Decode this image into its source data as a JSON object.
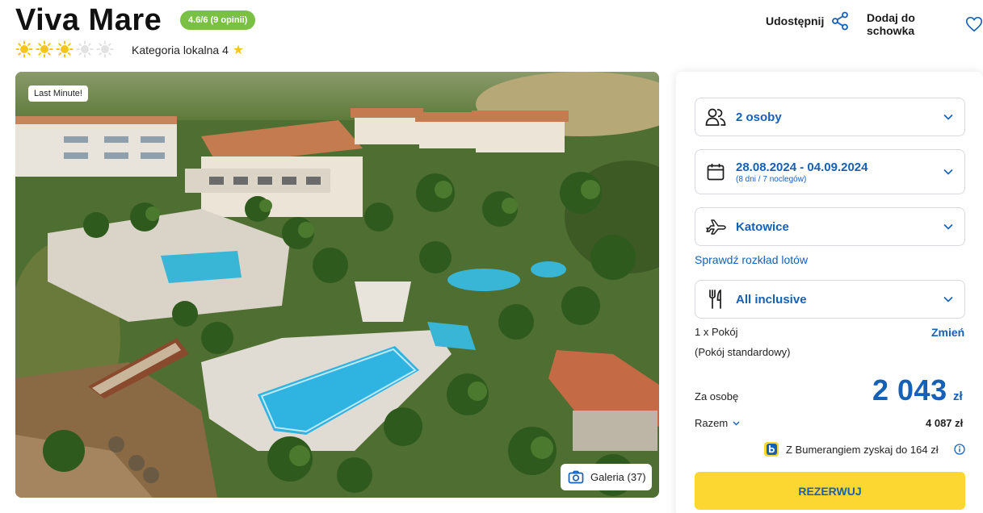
{
  "hotel": {
    "name": "Viva Mare",
    "rating_badge": "4.6/6 (9 opinii)",
    "stars_filled": 3,
    "stars_total": 5,
    "category_label": "Kategoria lokalna 4"
  },
  "actions": {
    "share_label": "Udostępnij",
    "favorite_label": "Dodaj do schowka"
  },
  "photo": {
    "badge": "Last Minute!",
    "gallery_label": "Galeria (37)"
  },
  "booking": {
    "persons": "2 osoby",
    "dates": "28.08.2024 - 04.09.2024",
    "dates_sub": "(8 dni / 7 noclegów)",
    "departure": "Katowice",
    "flight_schedule_link": "Sprawdź rozkład lotów",
    "board": "All inclusive",
    "room_count": "1 x Pokój",
    "change_label": "Zmień",
    "room_type": "(Pokój standardowy)",
    "per_person_label": "Za osobę",
    "price_per_person": "2 043",
    "currency": "zł",
    "total_label": "Razem",
    "total_value": "4 087 zł",
    "bumerang_text": "Z Bumerangiem zyskaj do 164 zł",
    "reserve_label": "REZERWUJ"
  },
  "colors": {
    "accent_blue": "#1660b6",
    "rating_green": "#7ac143",
    "reserve_yellow": "#fcd731",
    "sun_yellow": "#f5c518"
  }
}
